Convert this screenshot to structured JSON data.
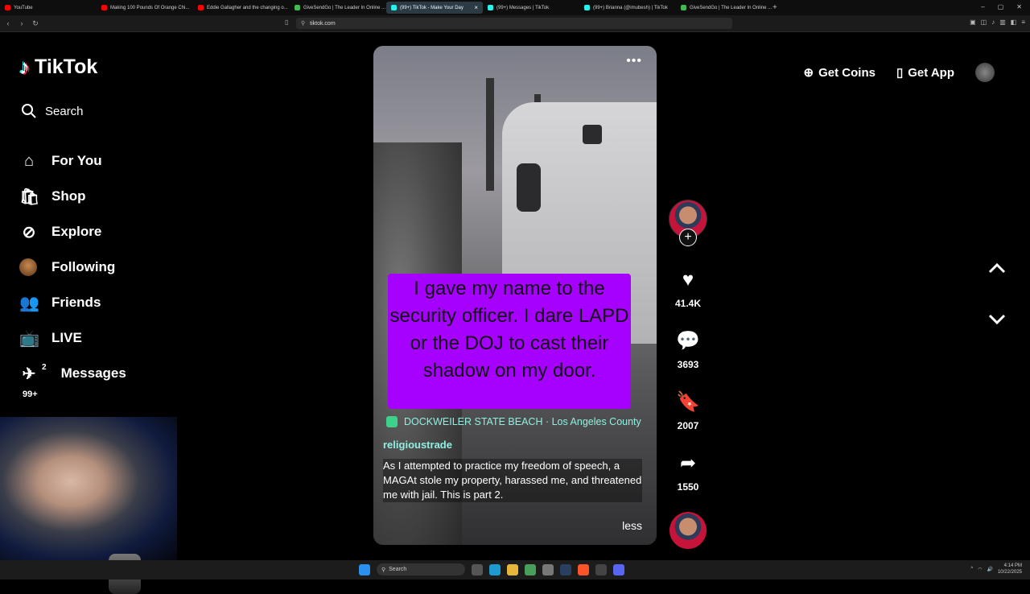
{
  "browser": {
    "tabs": [
      {
        "label": "YouTube",
        "color": "#ff0000",
        "active": false
      },
      {
        "label": "Making 100 Pounds Of Orange Chi...",
        "color": "#ff0000",
        "active": false
      },
      {
        "label": "Eddie Gallagher and the changing o...",
        "color": "#ff0000",
        "active": false
      },
      {
        "label": "GiveSendGo | The Leader In Online ...",
        "color": "#3fb950",
        "active": false
      },
      {
        "label": "(99+) TikTok - Make Your Day",
        "color": "#25f4ee",
        "active": true
      },
      {
        "label": "(99+) Messages | TikTok",
        "color": "#25f4ee",
        "active": false
      },
      {
        "label": "(99+) Brianna (@imubesh) | TikTok",
        "color": "#25f4ee",
        "active": false
      },
      {
        "label": "GiveSendGo | The Leader In Online ...",
        "color": "#3fb950",
        "active": false
      }
    ],
    "url": "tiktok.com"
  },
  "sidebar": {
    "brand": "TikTok",
    "search_label": "Search",
    "items": [
      {
        "label": "For You",
        "icon": "home-icon"
      },
      {
        "label": "Shop",
        "icon": "shop-icon"
      },
      {
        "label": "Explore",
        "icon": "compass-icon"
      },
      {
        "label": "Following",
        "icon": "avatar"
      },
      {
        "label": "Friends",
        "icon": "friends-icon"
      },
      {
        "label": "LIVE",
        "icon": "live-icon"
      },
      {
        "label": "Messages",
        "icon": "messages-icon"
      }
    ],
    "messages_badge": "2",
    "activity_badge": "99+"
  },
  "header": {
    "get_coins": "Get Coins",
    "get_app": "Get App"
  },
  "video": {
    "caption_overlay": "I gave my name to the security officer. I dare LAPD or the DOJ to cast their shadow on my door.",
    "location": "DOCKWEILER STATE BEACH · Los Angeles County",
    "username": "religioustrade",
    "description": "As I attempted to practice my freedom of speech, a MAGAt stole my property, harassed me, and threatened me with jail. This is part 2.",
    "less_label": "less"
  },
  "actions": {
    "likes": "41.4K",
    "comments": "3693",
    "saves": "2007",
    "shares": "1550"
  },
  "taskbar": {
    "search_label": "Search",
    "time": "4:14 PM",
    "date": "10/22/2025"
  }
}
